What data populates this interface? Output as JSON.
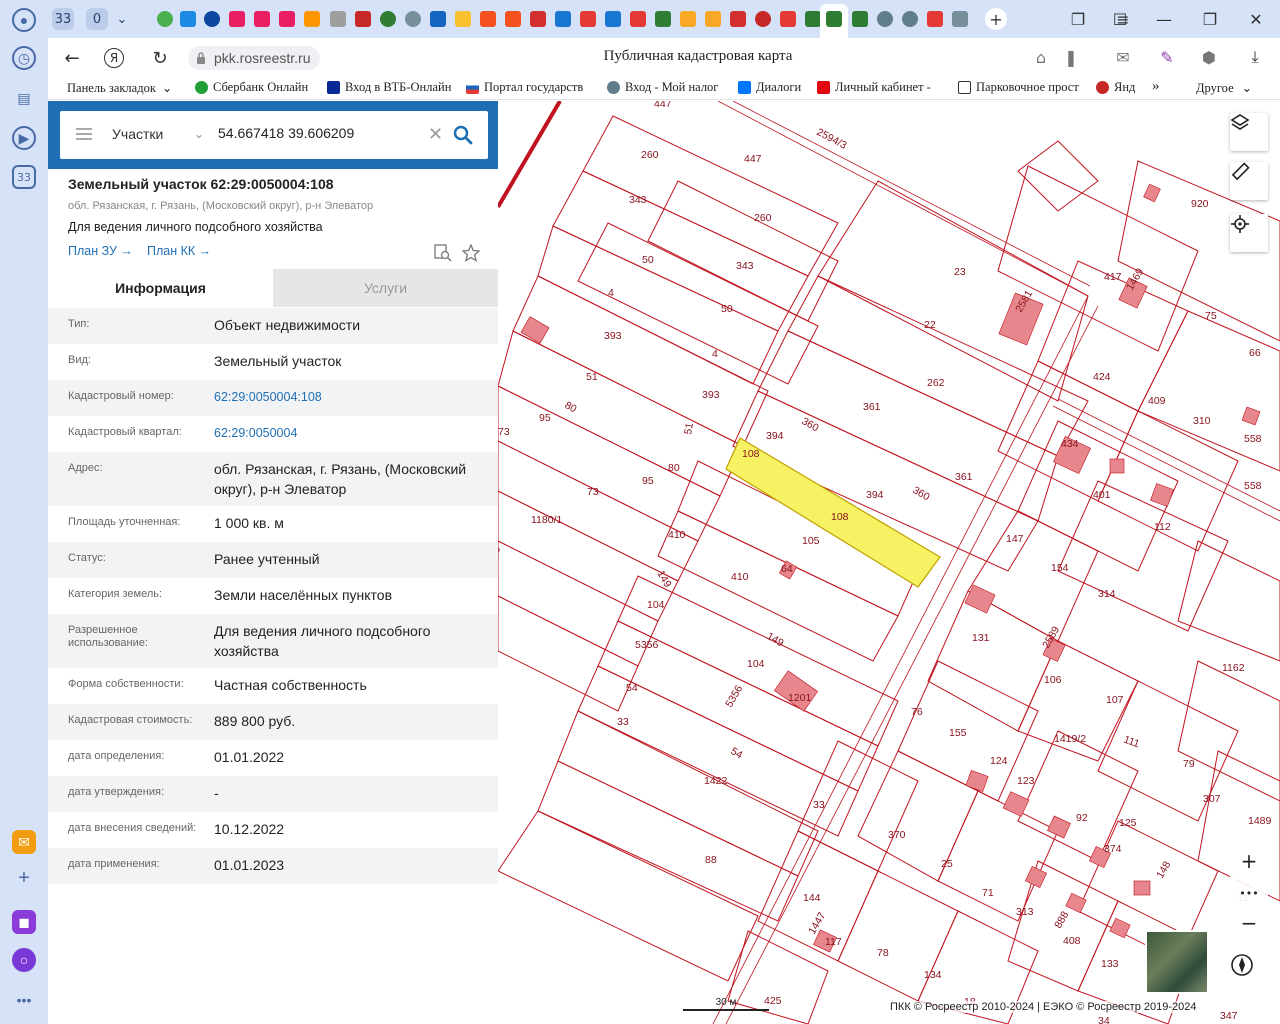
{
  "browser": {
    "tab_count": "33",
    "incognito_count": "0",
    "sidebar_badge": "33",
    "url": "pkk.rosreestr.ru",
    "title": "Публичная кадастровая карта",
    "download_count": "1"
  },
  "bookmarks": {
    "panel_label": "Панель закладок",
    "items": [
      "Сбербанк Онлайн",
      "Вход в ВТБ-Онлайн",
      "Портал государств",
      "Вход - Мой налог",
      "Диалоги",
      "Личный кабинет -",
      "Парковочное прост",
      "Янд"
    ],
    "more_label": "»",
    "other_label": "Другое"
  },
  "search": {
    "type": "Участки",
    "query": "54.667418 39.606209"
  },
  "object": {
    "title": "Земельный участок 62:29:0050004:108",
    "address": "обл. Рязанская, г. Рязань, (Московский округ), р-н Элеватор",
    "purpose": "Для ведения личного подсобного хозяйства",
    "plan_zu": "План ЗУ →",
    "plan_kk": "План КК →"
  },
  "tabs": {
    "info": "Информация",
    "services": "Услуги"
  },
  "info": [
    {
      "label": "Тип:",
      "value": "Объект недвижимости"
    },
    {
      "label": "Вид:",
      "value": "Земельный участок"
    },
    {
      "label": "Кадастровый номер:",
      "value": "62:29:0050004:108"
    },
    {
      "label": "Кадастровый квартал:",
      "value": "62:29:0050004"
    },
    {
      "label": "Адрес:",
      "value": "обл. Рязанская, г. Рязань, (Московский округ), р-н Элеватор"
    },
    {
      "label": "Площадь уточненная:",
      "value": "1 000 кв. м"
    },
    {
      "label": "Статус:",
      "value": "Ранее учтенный"
    },
    {
      "label": "Категория земель:",
      "value": "Земли населённых пунктов"
    },
    {
      "label": "Разрешенное использование:",
      "value": "Для ведения личного подсобного хозяйства"
    },
    {
      "label": "Форма собственности:",
      "value": "Частная собственность"
    },
    {
      "label": "Кадастровая стоимость:",
      "value": "889 800 руб."
    },
    {
      "label": "дата определения:",
      "value": "01.01.2022"
    },
    {
      "label": "дата утверждения:",
      "value": "-"
    },
    {
      "label": "дата внесения сведений:",
      "value": "10.12.2022"
    },
    {
      "label": "дата применения:",
      "value": "01.01.2023"
    }
  ],
  "map": {
    "parcel_labels": [
      "447",
      "260",
      "447",
      "343",
      "260",
      "2594/3",
      "920",
      "50",
      "343",
      "23",
      "4",
      "50",
      "417",
      "1469",
      "75",
      "393",
      "22",
      "2581",
      "66",
      "4",
      "424",
      "51",
      "262",
      "409",
      "310",
      "393",
      "361",
      "80",
      "95",
      "360",
      "394",
      "51",
      "434",
      "558",
      "73",
      "108",
      "558",
      "95",
      "394",
      "360",
      "361",
      "80",
      "401",
      "112",
      "73",
      "108",
      "105",
      "147",
      "1180/1",
      "410",
      "46",
      "64",
      "154",
      "314",
      "149",
      "410",
      "104",
      "149",
      "131",
      "2589",
      "1162",
      "5356",
      "104",
      "106",
      "107",
      "54",
      "5356",
      "1201",
      "76",
      "155",
      "1419/2",
      "111",
      "33",
      "54",
      "124",
      "79",
      "123",
      "307",
      "33",
      "370",
      "92",
      "125",
      "374",
      "1422",
      "25",
      "1489",
      "88",
      "148",
      "144",
      "71",
      "313",
      "888",
      "1447",
      "117",
      "78",
      "408",
      "133",
      "134",
      "18",
      "425",
      "347",
      "34",
      "11"
    ],
    "selected_parcel": "108",
    "copyright": "ПКК © Росреестр 2010-2024 | ЕЭКО © Росреестр 2019-2024",
    "scale": "30 м",
    "zoom_in": "+",
    "zoom_out": "−",
    "more": "•••"
  },
  "colors": {
    "panel_blue": "#1f6fb4",
    "parcel_red": "#c0131f",
    "selected_yellow": "#f7f264",
    "building_pink": "#e7878d"
  }
}
